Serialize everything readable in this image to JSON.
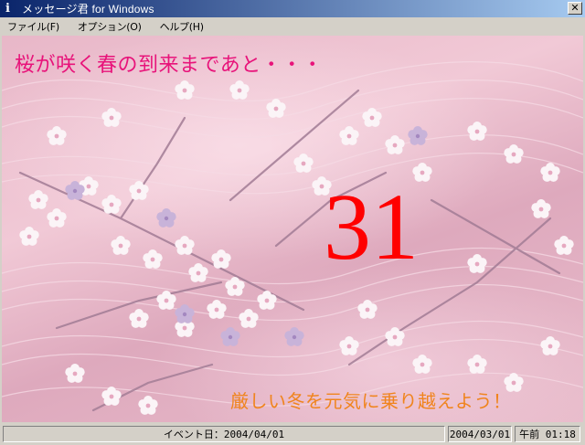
{
  "window": {
    "title": "メッセージ君 for Windows",
    "icon": "info-icon",
    "close_glyph": "✕"
  },
  "menu": {
    "items": [
      "ファイル(F)",
      "オプション(O)",
      "ヘルプ(H)"
    ]
  },
  "content": {
    "headline": "桜が咲く春の到来まであと・・・",
    "counter": "31",
    "footer_message": "厳しい冬を元気に乗り越えよう！",
    "colors": {
      "headline": "#e8137a",
      "counter": "#ff0000",
      "footer_message": "#f0841d"
    }
  },
  "status": {
    "event_date": "イベント日：2004/04/01",
    "current_date": "2004/03/01",
    "current_time": "午前 01:18"
  }
}
